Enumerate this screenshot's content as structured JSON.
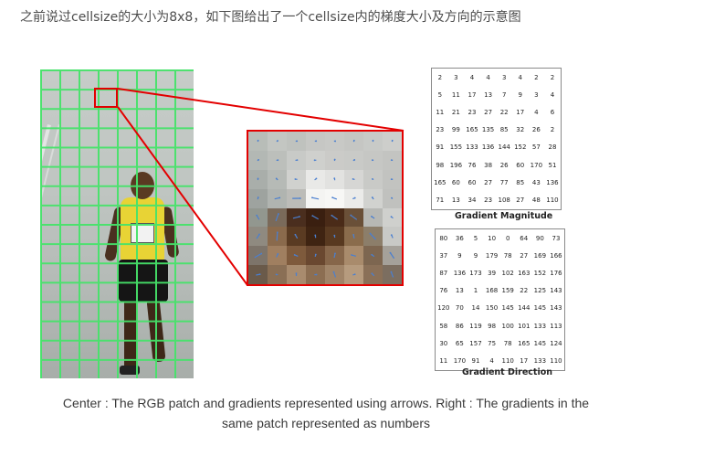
{
  "intro_text": "之前说过cellsize的大小为8x8，如下图给出了一个cellsize内的梯度大小及方向的示意图",
  "runner_bib_text": "NAME",
  "colors": {
    "grid": "#46e36a",
    "highlight": "#e30000",
    "arrow": "#4a7fd0"
  },
  "patch_colors": [
    [
      "#b8bdb8",
      "#c3c6c2",
      "#bfc2be",
      "#c6c7c4",
      "#c8c9c6",
      "#c5c6c3",
      "#c8cac7",
      "#cdcecb"
    ],
    [
      "#b3b8b4",
      "#bcbfbb",
      "#c8cac7",
      "#cfd0cd",
      "#cbcbc8",
      "#c9cac7",
      "#c6c7c4",
      "#c3c4c1"
    ],
    [
      "#a9aeaa",
      "#b6bab6",
      "#d0d1ce",
      "#e9e9e7",
      "#e2e2e0",
      "#d6d6d4",
      "#c9cac7",
      "#c2c3c0"
    ],
    [
      "#9ea39f",
      "#b0b4b0",
      "#bcbcb8",
      "#f4f4f2",
      "#f7f7f5",
      "#ebebe9",
      "#d1d2cf",
      "#c0c1be"
    ],
    [
      "#92978f",
      "#7a6a5a",
      "#4a2e1e",
      "#3a1f10",
      "#4a2b18",
      "#6a5038",
      "#b7b8b4",
      "#cfd0cd"
    ],
    [
      "#8f8a80",
      "#8a6a4c",
      "#5a3b22",
      "#3f2412",
      "#583920",
      "#8a6c4c",
      "#8c7e6a",
      "#c8c9c6"
    ],
    [
      "#7d746a",
      "#a07f60",
      "#7e5a3c",
      "#6a4830",
      "#86664a",
      "#a98b6c",
      "#7d6650",
      "#a5a19a"
    ],
    [
      "#6a5a4a",
      "#8a6f55",
      "#a88b6e",
      "#8c6e52",
      "#a08468",
      "#b69b7e",
      "#8a7058",
      "#7c6e60"
    ]
  ],
  "gradient_magnitude": {
    "title": "Gradient Magnitude",
    "rows": [
      [
        "2",
        "3",
        "4",
        "4",
        "3",
        "4",
        "2",
        "2"
      ],
      [
        "5",
        "11",
        "17",
        "13",
        "7",
        "9",
        "3",
        "4"
      ],
      [
        "11",
        "21",
        "23",
        "27",
        "22",
        "17",
        "4",
        "6"
      ],
      [
        "23",
        "99",
        "165",
        "135",
        "85",
        "32",
        "26",
        "2"
      ],
      [
        "91",
        "155",
        "133",
        "136",
        "144",
        "152",
        "57",
        "28"
      ],
      [
        "98",
        "196",
        "76",
        "38",
        "26",
        "60",
        "170",
        "51"
      ],
      [
        "165",
        "60",
        "60",
        "27",
        "77",
        "85",
        "43",
        "136"
      ],
      [
        "71",
        "13",
        "34",
        "23",
        "108",
        "27",
        "48",
        "110"
      ]
    ]
  },
  "gradient_direction": {
    "title": "Gradient Direction",
    "rows": [
      [
        "80",
        "36",
        "5",
        "10",
        "0",
        "64",
        "90",
        "73"
      ],
      [
        "37",
        "9",
        "9",
        "179",
        "78",
        "27",
        "169",
        "166"
      ],
      [
        "87",
        "136",
        "173",
        "39",
        "102",
        "163",
        "152",
        "176"
      ],
      [
        "76",
        "13",
        "1",
        "168",
        "159",
        "22",
        "125",
        "143"
      ],
      [
        "120",
        "70",
        "14",
        "150",
        "145",
        "144",
        "145",
        "143"
      ],
      [
        "58",
        "86",
        "119",
        "98",
        "100",
        "101",
        "133",
        "113"
      ],
      [
        "30",
        "65",
        "157",
        "75",
        "78",
        "165",
        "145",
        "124"
      ],
      [
        "11",
        "170",
        "91",
        "4",
        "110",
        "17",
        "133",
        "110"
      ]
    ]
  },
  "caption_line1": "Center : The RGB patch and gradients represented using arrows. Right : The gradients in the",
  "caption_line2": "same patch represented as numbers"
}
